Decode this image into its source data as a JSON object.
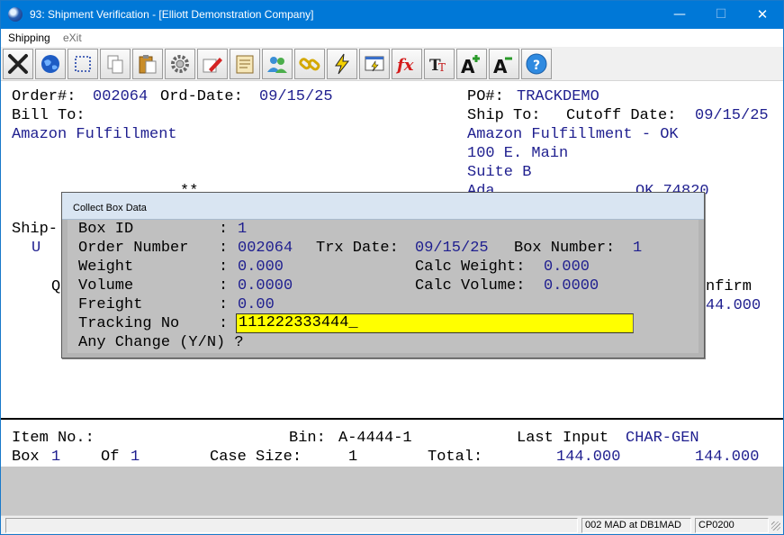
{
  "window": {
    "title": "93: Shipment Verification - [Elliott Demonstration Company]",
    "controls": {
      "minimize": "—",
      "maximize": "☐",
      "close": "✕"
    }
  },
  "menubar": {
    "items": [
      "Shipping",
      "eXit"
    ]
  },
  "toolbar": {
    "buttons": [
      "close-icon",
      "globe-icon",
      "select-icon",
      "copy-icon",
      "paste-icon",
      "settings-icon",
      "edit-icon",
      "notes-icon",
      "users-icon",
      "link-icon",
      "lightning-icon",
      "screen-icon",
      "fx-icon",
      "font-icon",
      "font-increase-icon",
      "font-decrease-icon",
      "help-icon"
    ]
  },
  "order": {
    "order_no_label": "Order#:",
    "order_no": "002064",
    "ord_date_label": "Ord-Date:",
    "ord_date": "09/15/25",
    "po_label": "PO#:",
    "po": "TRACKDEMO",
    "bill_to_label": "Bill To:",
    "bill_to_name": "Amazon Fulfillment",
    "ship_to_label": "Ship To:",
    "cutoff_label": "Cutoff Date:",
    "cutoff_date": "09/15/25",
    "ship_to_lines": [
      "Amazon Fulfillment - OK",
      "100 E. Main",
      "Suite B"
    ],
    "ship_to_partial_city": "Ada",
    "ship_to_partial_state": "OK 74820",
    "stars": "**",
    "ship_partial": "Ship-",
    "u_partial": "U",
    "q_partial": "Q",
    "confirm_partial": "nfirm",
    "confirm_qty": "44.000"
  },
  "dialog": {
    "title": "Collect Box Data",
    "box_id_label": "Box ID",
    "box_id": "1",
    "order_number_label": "Order Number",
    "order_number": "002064",
    "trx_date_label": "Trx Date:",
    "trx_date": "09/15/25",
    "box_number_label": "Box Number:",
    "box_number": "1",
    "weight_label": "Weight",
    "weight": "0.000",
    "calc_weight_label": "Calc Weight:",
    "calc_weight": "0.000",
    "volume_label": "Volume",
    "volume": "0.0000",
    "calc_volume_label": "Calc Volume:",
    "calc_volume": "0.0000",
    "freight_label": "Freight",
    "freight": "0.00",
    "tracking_label": "Tracking No",
    "tracking_value": "111222333444_",
    "change_prompt": "Any Change (Y/N) ?",
    "colon": ":"
  },
  "lower": {
    "item_label": "Item No.:",
    "bin_label": "Bin:",
    "bin": "A-4444-1",
    "last_input_label": "Last Input",
    "last_input": "CHAR-GEN",
    "box_label": "Box",
    "box": "1",
    "of_label": "Of",
    "of": "1",
    "case_size_label": "Case Size:",
    "case_size": "1",
    "total_label": "Total:",
    "total1": "144.000",
    "total2": "144.000"
  },
  "statusbar": {
    "field1": "",
    "field2": "002 MAD at DB1MAD",
    "field3": "CP0200"
  },
  "colors": {
    "title_bar": "#0078d7",
    "value_text": "#1f1f8f",
    "dialog_bg": "#c0c0c0",
    "tracking_bg": "#ffff00"
  }
}
